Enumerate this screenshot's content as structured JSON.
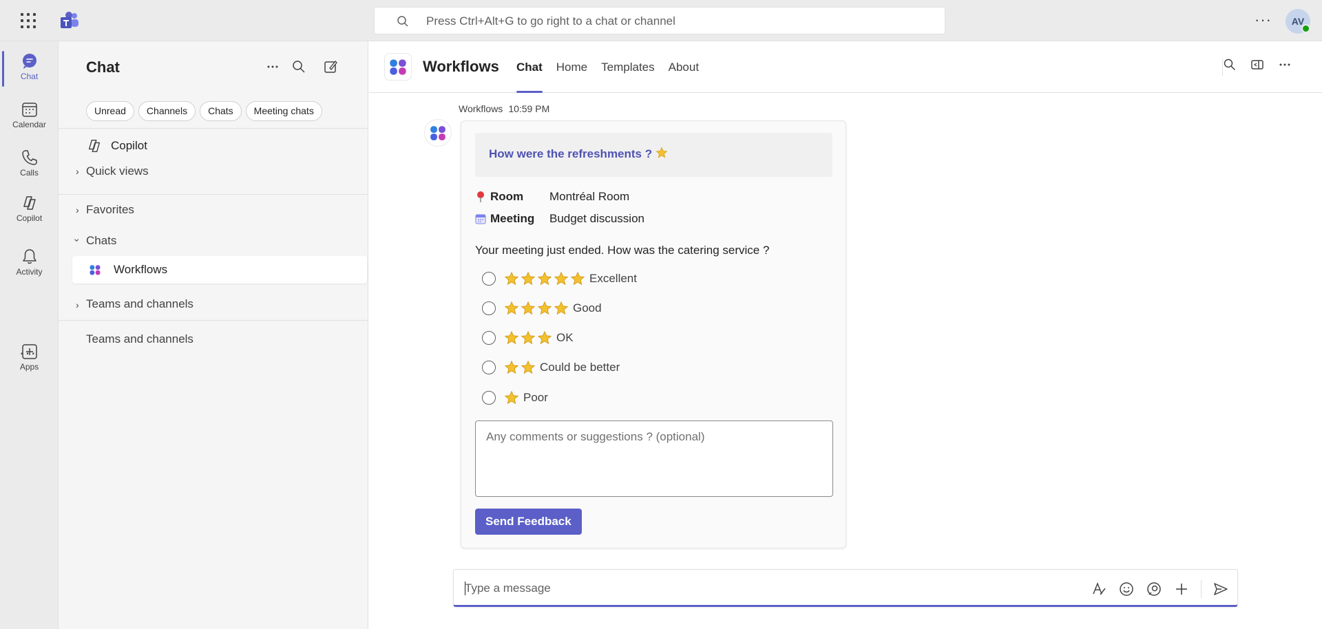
{
  "topbar": {
    "search_placeholder": "Press Ctrl+Alt+G to go right to a chat or channel",
    "avatar_initials": "AV",
    "more_label": "···"
  },
  "rail": {
    "items": [
      {
        "label": "Chat",
        "icon": "chat-icon",
        "active": true
      },
      {
        "label": "Calendar",
        "icon": "calendar-icon"
      },
      {
        "label": "Calls",
        "icon": "phone-icon"
      },
      {
        "label": "Copilot",
        "icon": "copilot-icon"
      },
      {
        "label": "Activity",
        "icon": "bell-icon"
      },
      {
        "label": "Apps",
        "icon": "plus-square-icon"
      }
    ],
    "more_label": "···"
  },
  "panel": {
    "title": "Chat",
    "filters": [
      "Unread",
      "Channels",
      "Chats",
      "Meeting chats"
    ],
    "copilot_label": "Copilot",
    "quick_views_label": "Quick views",
    "favorites_label": "Favorites",
    "chats_label": "Chats",
    "workflows_label": "Workflows",
    "teams_channels_label": "Teams and channels",
    "teams_channels_footer": "Teams and channels"
  },
  "header": {
    "app_name": "Workflows",
    "tabs": [
      "Chat",
      "Home",
      "Templates",
      "About"
    ],
    "active_tab": "Chat"
  },
  "message": {
    "sender": "Workflows",
    "time": "10:59 PM",
    "card": {
      "question_title": "How were the refreshments ?",
      "facts": [
        {
          "key": "Room",
          "value": "Montréal Room",
          "icon": "pin-icon"
        },
        {
          "key": "Meeting",
          "value": "Budget discussion",
          "icon": "calendar-icon"
        }
      ],
      "prompt": "Your meeting just ended. How was the catering service ?",
      "options": [
        {
          "label": "Excellent",
          "stars": 5
        },
        {
          "label": "Good",
          "stars": 4
        },
        {
          "label": "OK",
          "stars": 3
        },
        {
          "label": "Could be better",
          "stars": 2
        },
        {
          "label": "Poor",
          "stars": 1
        }
      ],
      "comment_placeholder": "Any comments or suggestions ? (optional)",
      "submit_label": "Send Feedback"
    }
  },
  "compose": {
    "placeholder": "Type a message"
  },
  "colors": {
    "accent": "#5b5fc7",
    "title_blue": "#4f52b2",
    "star": "#f2c12e"
  }
}
